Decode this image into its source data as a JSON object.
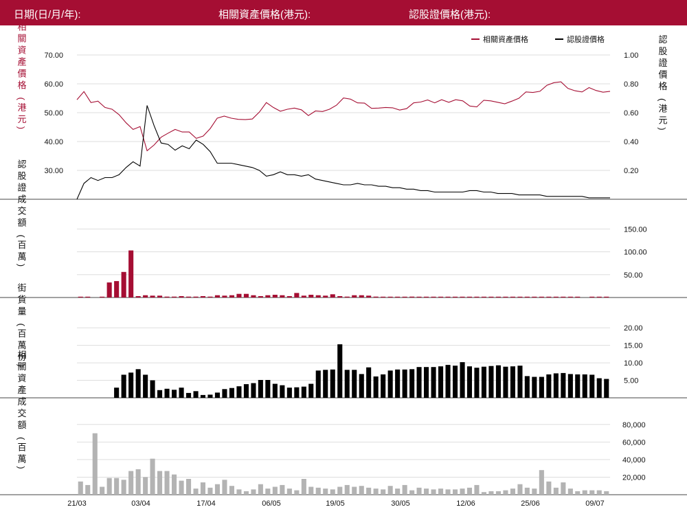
{
  "header": {
    "date_label": "日期(日/月/年):",
    "underlying_price_label": "相關資產價格(港元):",
    "warrant_price_label": "認股證價格(港元):"
  },
  "colors": {
    "brand": "#a50e33",
    "warrant": "#000000",
    "asset_turnover": "#b3b3b3",
    "grid": "#dddddd"
  },
  "chart_data": [
    {
      "type": "line",
      "legend": [
        {
          "name": "相關資產價格",
          "color": "#a50e33"
        },
        {
          "name": "認股證價格",
          "color": "#000000"
        }
      ],
      "x_tick_labels": [
        "21/03",
        "03/04",
        "17/04",
        "06/05",
        "19/05",
        "30/05",
        "12/06",
        "25/06",
        "09/07"
      ],
      "ylabel_left": "相關資產價格 (港元)",
      "ylabel_right": "認股證價格 (港元)",
      "y_left_ticks": [
        "30.00",
        "40.00",
        "50.00",
        "60.00",
        "70.00"
      ],
      "y_right_ticks": [
        "0.20",
        "0.40",
        "0.60",
        "0.80",
        "1.00"
      ],
      "y_left_range": [
        20,
        70
      ],
      "y_right_range": [
        0,
        1
      ],
      "series": [
        {
          "name": "相關資產價格",
          "axis": "left",
          "values": [
            54.5,
            57.3,
            53.5,
            54.0,
            51.8,
            51.2,
            49.3,
            46.5,
            44.2,
            45.2,
            36.8,
            38.8,
            41.5,
            42.9,
            44.2,
            43.3,
            43.3,
            41.1,
            41.9,
            44.5,
            48.1,
            48.8,
            48.1,
            47.7,
            47.6,
            47.8,
            50.2,
            53.5,
            51.8,
            50.5,
            51.2,
            51.6,
            51.0,
            49.0,
            50.6,
            50.4,
            51.2,
            52.6,
            55.1,
            54.7,
            53.4,
            53.3,
            51.5,
            51.6,
            51.8,
            51.7,
            50.9,
            51.4,
            53.4,
            53.7,
            54.4,
            53.4,
            54.5,
            53.6,
            54.5,
            54.1,
            52.3,
            52.0,
            54.3,
            54.1,
            53.6,
            53.1,
            54.0,
            55.0,
            57.2,
            57.0,
            57.4,
            59.5,
            60.4,
            60.7,
            58.4,
            57.6,
            57.2,
            58.7,
            57.7,
            57.1,
            57.4
          ]
        },
        {
          "name": "認股證價格",
          "axis": "right",
          "values": [
            0.0,
            0.11,
            0.15,
            0.13,
            0.15,
            0.15,
            0.17,
            0.22,
            0.26,
            0.23,
            0.65,
            0.51,
            0.39,
            0.38,
            0.34,
            0.37,
            0.35,
            0.41,
            0.38,
            0.33,
            0.25,
            0.25,
            0.25,
            0.24,
            0.23,
            0.22,
            0.2,
            0.16,
            0.17,
            0.19,
            0.17,
            0.17,
            0.16,
            0.17,
            0.14,
            0.13,
            0.12,
            0.11,
            0.1,
            0.1,
            0.11,
            0.1,
            0.1,
            0.09,
            0.09,
            0.08,
            0.08,
            0.07,
            0.07,
            0.06,
            0.06,
            0.05,
            0.05,
            0.05,
            0.05,
            0.05,
            0.06,
            0.06,
            0.05,
            0.05,
            0.04,
            0.04,
            0.04,
            0.03,
            0.03,
            0.03,
            0.03,
            0.02,
            0.02,
            0.02,
            0.02,
            0.02,
            0.02,
            0.01,
            0.01,
            0.01,
            0.01
          ]
        }
      ]
    },
    {
      "type": "bar",
      "ylabel": "認股證成交額 (百萬)",
      "y_ticks": [
        "50.00",
        "100.00",
        "150.00"
      ],
      "y_range": [
        0,
        170
      ],
      "color": "#a50e33",
      "values": [
        1,
        1,
        0,
        1,
        33,
        36,
        56,
        103,
        3,
        5,
        4,
        4,
        2,
        2,
        3,
        2,
        2,
        3,
        2,
        5,
        4,
        5,
        8,
        8,
        5,
        3,
        5,
        6,
        5,
        3,
        10,
        4,
        6,
        5,
        4,
        7,
        3,
        2,
        5,
        5,
        4,
        2,
        1,
        1,
        1,
        1,
        2,
        1,
        1,
        1,
        1,
        1,
        1,
        1,
        1,
        1,
        1,
        1,
        1,
        1,
        1,
        1,
        1,
        1,
        1,
        1,
        1,
        1,
        1,
        1,
        0,
        1,
        1,
        1
      ]
    },
    {
      "type": "bar",
      "ylabel": "街貨量 (百萬份)",
      "y_ticks": [
        "5.00",
        "10.00",
        "15.00",
        "20.00"
      ],
      "y_range": [
        0,
        22
      ],
      "color": "#000000",
      "values": [
        0,
        0,
        0,
        0,
        0,
        2.9,
        6.6,
        7.2,
        8.2,
        6.6,
        5.0,
        2.2,
        2.6,
        2.3,
        2.9,
        1.4,
        1.9,
        0.8,
        0.9,
        1.5,
        2.5,
        2.8,
        3.3,
        3.9,
        4.2,
        5.1,
        5.1,
        4.0,
        3.6,
        2.9,
        3.0,
        3.2,
        4.0,
        7.8,
        8.0,
        8.1,
        15.3,
        8.0,
        8.0,
        6.8,
        8.7,
        6.1,
        6.7,
        7.8,
        8.1,
        8.1,
        8.2,
        8.8,
        8.8,
        8.8,
        9.0,
        9.4,
        9.2,
        10.2,
        9.0,
        8.6,
        8.9,
        9.1,
        9.3,
        8.9,
        9.0,
        9.2,
        6.2,
        6.0,
        6.0,
        6.7,
        7.0,
        7.1,
        6.8,
        6.7,
        6.7,
        6.6,
        5.6,
        5.4
      ]
    },
    {
      "type": "bar",
      "ylabel": "相關資產成交額 (百萬)",
      "y_ticks": [
        "20,000",
        "40,000",
        "60,000",
        "80,000"
      ],
      "y_range": [
        0,
        90000
      ],
      "color": "#b3b3b3",
      "values": [
        15000,
        11000,
        70000,
        9000,
        19000,
        19000,
        17000,
        27000,
        29000,
        20000,
        41000,
        27000,
        27000,
        23000,
        16000,
        18000,
        7000,
        14000,
        8000,
        12000,
        17000,
        10000,
        6000,
        4000,
        6000,
        12000,
        7000,
        9000,
        11000,
        7000,
        5000,
        18000,
        9000,
        8000,
        7000,
        6000,
        9000,
        11000,
        9000,
        10000,
        8000,
        7000,
        6000,
        10000,
        7000,
        11000,
        5000,
        8000,
        7000,
        6000,
        7000,
        6000,
        6000,
        7000,
        8000,
        11000,
        3000,
        4000,
        4000,
        5000,
        7000,
        12000,
        8000,
        7000,
        28000,
        15000,
        8000,
        14000,
        7000,
        4000,
        5000,
        5000,
        5000,
        4000
      ]
    }
  ]
}
